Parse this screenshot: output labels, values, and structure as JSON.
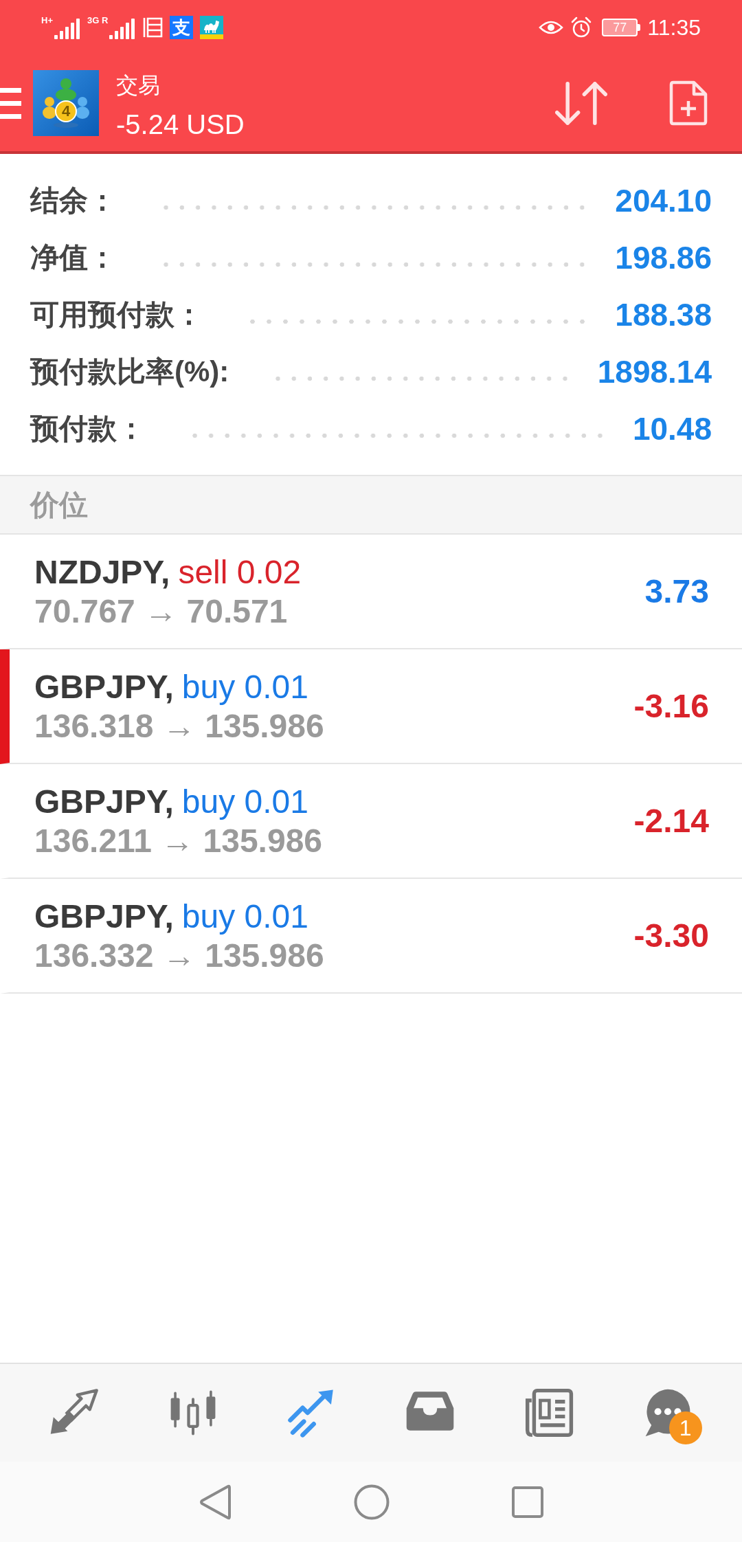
{
  "status_bar": {
    "signals": [
      {
        "label": "H+"
      },
      {
        "label": "3G R"
      }
    ],
    "apps": [
      {
        "kind": "document"
      },
      {
        "kind": "tile",
        "glyph": "支"
      },
      {
        "kind": "camel"
      }
    ],
    "battery": "77",
    "time": "11:35"
  },
  "header": {
    "logo_mark": "4",
    "title": "交易",
    "subtitle": "-5.24 USD"
  },
  "account": [
    {
      "label": "结余：",
      "value": "204.10"
    },
    {
      "label": "净值：",
      "value": "198.86"
    },
    {
      "label": "可用预付款：",
      "value": "188.38"
    },
    {
      "label": "预付款比率(%):",
      "value": "1898.14"
    },
    {
      "label": "预付款：",
      "value": "10.48"
    }
  ],
  "section": {
    "title": "价位"
  },
  "positions": [
    {
      "symbol": "NZDJPY,",
      "order": {
        "text": "sell 0.02",
        "color": "#d9232b"
      },
      "prices": "70.767 → 70.571",
      "profit": {
        "text": "3.73",
        "color": "#1a7ae6"
      },
      "selected": false
    },
    {
      "symbol": "GBPJPY,",
      "order": {
        "text": "buy 0.01",
        "color": "#1a7ae6"
      },
      "prices": "136.318 → 135.986",
      "profit": {
        "text": "-3.16",
        "color": "#d9232b"
      },
      "selected": true
    },
    {
      "symbol": "GBPJPY,",
      "order": {
        "text": "buy 0.01",
        "color": "#1a7ae6"
      },
      "prices": "136.211 → 135.986",
      "profit": {
        "text": "-2.14",
        "color": "#d9232b"
      },
      "selected": false
    },
    {
      "symbol": "GBPJPY,",
      "order": {
        "text": "buy 0.01",
        "color": "#1a7ae6"
      },
      "prices": "136.332 → 135.986",
      "profit": {
        "text": "-3.30",
        "color": "#d9232b"
      },
      "selected": false
    }
  ],
  "bottom_nav": [
    {
      "kind": "quotes",
      "selected": false
    },
    {
      "kind": "chart",
      "selected": false
    },
    {
      "kind": "trade",
      "selected": true
    },
    {
      "kind": "history",
      "selected": false
    },
    {
      "kind": "news",
      "selected": false
    },
    {
      "kind": "messages",
      "selected": false,
      "badge": "1"
    }
  ]
}
